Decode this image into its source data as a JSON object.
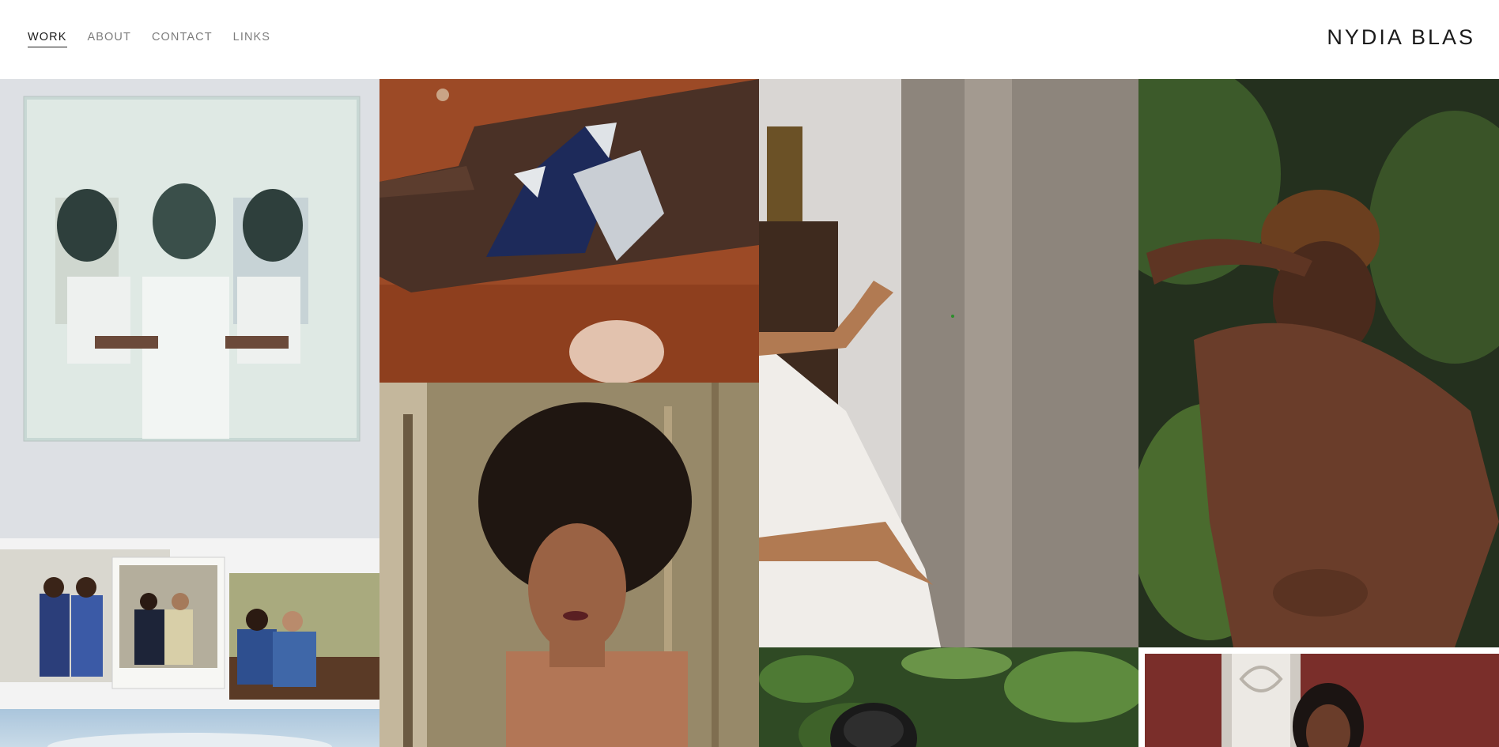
{
  "site": {
    "title": "NYDIA BLAS"
  },
  "nav": {
    "items": [
      {
        "label": "WORK",
        "active": true
      },
      {
        "label": "ABOUT",
        "active": false
      },
      {
        "label": "CONTACT",
        "active": false
      },
      {
        "label": "LINKS",
        "active": false
      }
    ]
  },
  "colors": {
    "text_primary": "#1a1a1a",
    "text_muted": "#7d7d7d",
    "background": "#ffffff"
  }
}
